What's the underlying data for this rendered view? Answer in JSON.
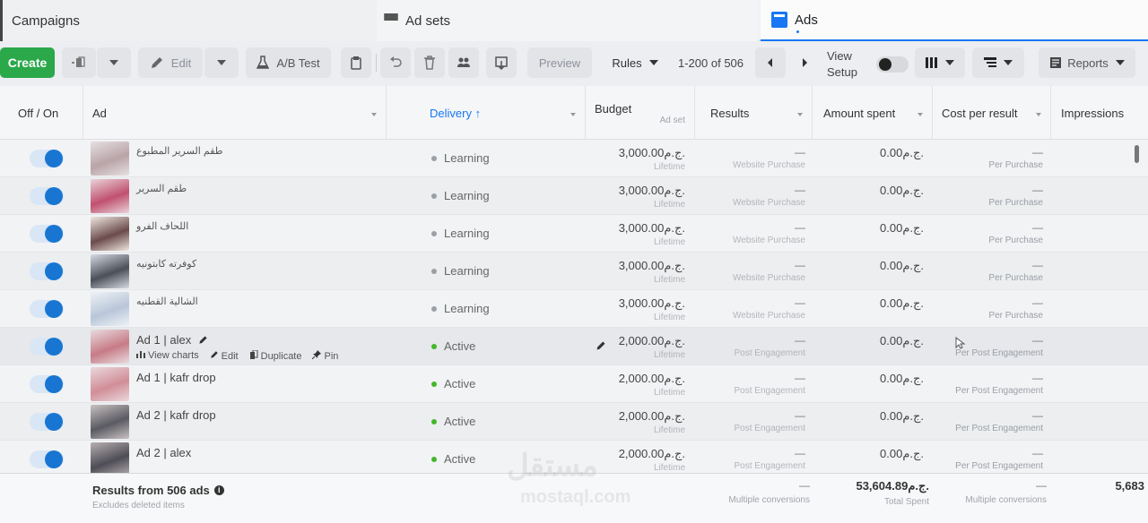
{
  "tabs": {
    "campaigns": "Campaigns",
    "adsets": "Ad sets",
    "ads": "Ads"
  },
  "toolbar": {
    "create": "Create",
    "edit": "Edit",
    "ab_test": "A/B Test",
    "preview": "Preview",
    "rules": "Rules",
    "pager": "1-200 of 506",
    "view_setup_line1": "View",
    "view_setup_line2": "Setup",
    "reports": "Reports"
  },
  "columns": {
    "off_on": "Off / On",
    "ad": "Ad",
    "delivery": "Delivery ↑",
    "budget": "Budget",
    "budget_sub": "Ad set",
    "results": "Results",
    "amount_spent": "Amount spent",
    "cost_per_result": "Cost per result",
    "impressions": "Impressions"
  },
  "row_actions": {
    "view_charts": "View charts",
    "edit": "Edit",
    "duplicate": "Duplicate",
    "pin": "Pin"
  },
  "rows": [
    {
      "name": "طقم السرير المطبوع",
      "delivery": "Learning",
      "budget": "3,000.00ج.م.",
      "budget_type": "Lifetime",
      "results": "—",
      "results_type": "Website Purchase",
      "amount": "0.00ج.م.",
      "cpr": "—",
      "cpr_type": "Per Purchase"
    },
    {
      "name": "طقم السرير",
      "delivery": "Learning",
      "budget": "3,000.00ج.م.",
      "budget_type": "Lifetime",
      "results": "—",
      "results_type": "Website Purchase",
      "amount": "0.00ج.م.",
      "cpr": "—",
      "cpr_type": "Per Purchase"
    },
    {
      "name": "اللحاف الفرو",
      "delivery": "Learning",
      "budget": "3,000.00ج.م.",
      "budget_type": "Lifetime",
      "results": "—",
      "results_type": "Website Purchase",
      "amount": "0.00ج.م.",
      "cpr": "—",
      "cpr_type": "Per Purchase"
    },
    {
      "name": "كوفرته كابتونيه",
      "delivery": "Learning",
      "budget": "3,000.00ج.م.",
      "budget_type": "Lifetime",
      "results": "—",
      "results_type": "Website Purchase",
      "amount": "0.00ج.م.",
      "cpr": "—",
      "cpr_type": "Per Purchase"
    },
    {
      "name": "الشالية القطنيه",
      "delivery": "Learning",
      "budget": "3,000.00ج.م.",
      "budget_type": "Lifetime",
      "results": "—",
      "results_type": "Website Purchase",
      "amount": "0.00ج.م.",
      "cpr": "—",
      "cpr_type": "Per Purchase"
    },
    {
      "name": "Ad 1 | alex",
      "delivery": "Active",
      "budget": "2,000.00ج.م.",
      "budget_type": "Lifetime",
      "results": "—",
      "results_type": "Post Engagement",
      "amount": "0.00ج.م.",
      "cpr": "—",
      "cpr_type": "Per Post Engagement"
    },
    {
      "name": "Ad 1 | kafr drop",
      "delivery": "Active",
      "budget": "2,000.00ج.م.",
      "budget_type": "Lifetime",
      "results": "—",
      "results_type": "Post Engagement",
      "amount": "0.00ج.م.",
      "cpr": "—",
      "cpr_type": "Per Post Engagement"
    },
    {
      "name": "Ad 2 | kafr drop",
      "delivery": "Active",
      "budget": "2,000.00ج.م.",
      "budget_type": "Lifetime",
      "results": "—",
      "results_type": "Post Engagement",
      "amount": "0.00ج.م.",
      "cpr": "—",
      "cpr_type": "Per Post Engagement"
    },
    {
      "name": "Ad 2 | alex",
      "delivery": "Active",
      "budget": "2,000.00ج.م.",
      "budget_type": "Lifetime",
      "results": "—",
      "results_type": "Post Engagement",
      "amount": "0.00ج.م.",
      "cpr": "—",
      "cpr_type": "Per Post Engagement"
    }
  ],
  "totals": {
    "label": "Results from 506 ads",
    "sub": "Excludes deleted items",
    "results": "—",
    "results_sub": "Multiple conversions",
    "amount": "53,604.89ج.م.",
    "amount_sub": "Total Spent",
    "cpr": "—",
    "cpr_sub": "Multiple conversions",
    "impressions": "5,683"
  },
  "watermark": {
    "ar": "مستقل",
    "en": "mostaql.com"
  },
  "colors": {
    "accent": "#1877f2",
    "create": "#2aa84a",
    "learning_dot": "#9aa0a6",
    "active_dot": "#42b72a"
  }
}
